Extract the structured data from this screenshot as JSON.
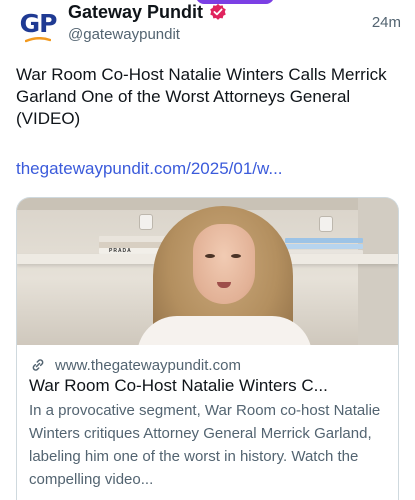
{
  "header": {
    "avatar_text": "GP",
    "display_name": "Gateway Pundit",
    "handle": "@gatewaypundit",
    "timestamp": "24m",
    "verified_icon": "verified-badge-icon",
    "accent_color": "#e0245e"
  },
  "post": {
    "text": "War Room Co-Host Natalie Winters Calls Merrick Garland One of the Worst Attorneys General (VIDEO)",
    "link": "thegatewaypundit.com/2025/01/w...",
    "link_color": "#3b5bdb"
  },
  "card": {
    "image_books_label": "PRADA",
    "domain_icon": "link-icon",
    "domain": "www.thegatewaypundit.com",
    "title": "War Room Co-Host Natalie Winters C...",
    "description": "In a provocative segment, War Room co-host Natalie Winters critiques Attorney General Merrick Garland, labeling him one of the worst in history. Watch the compelling video..."
  }
}
